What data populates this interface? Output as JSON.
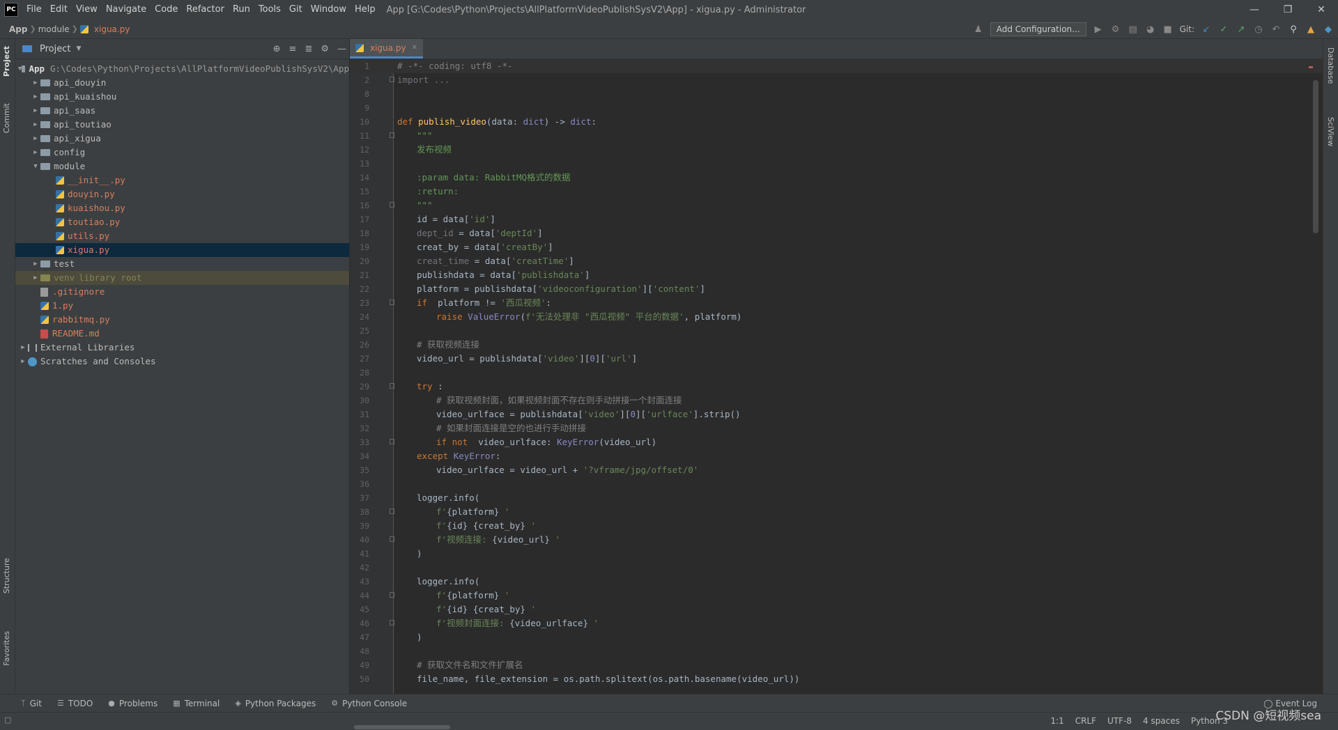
{
  "titlebar": {
    "logo": "PC",
    "menu": [
      "File",
      "Edit",
      "View",
      "Navigate",
      "Code",
      "Refactor",
      "Run",
      "Tools",
      "Git",
      "Window",
      "Help"
    ],
    "window_title": "App [G:\\Codes\\Python\\Projects\\AllPlatformVideoPublishSysV2\\App] - xigua.py - Administrator"
  },
  "navbar": {
    "breadcrumbs": [
      "App",
      "module",
      "xigua.py"
    ],
    "add_config": "Add Configuration...",
    "git_label": "Git:"
  },
  "left_stripe": {
    "project": "Project",
    "commit": "Commit",
    "structure": "Structure",
    "favorites": "Favorites"
  },
  "right_stripe": {
    "database": "Database",
    "sciview": "SciView"
  },
  "project_panel": {
    "title": "Project",
    "root_name": "App",
    "root_path": "G:\\Codes\\Python\\Projects\\AllPlatformVideoPublishSysV2\\App",
    "folders": [
      "api_douyin",
      "api_kuaishou",
      "api_saas",
      "api_toutiao",
      "api_xigua",
      "config"
    ],
    "module_name": "module",
    "module_files": [
      "__init__.py",
      "douyin.py",
      "kuaishou.py",
      "toutiao.py",
      "utils.py",
      "xigua.py"
    ],
    "test": "test",
    "venv": "venv",
    "venv_note": "library root",
    "root_files": [
      ".gitignore",
      "1.py",
      "rabbitmq.py",
      "README.md"
    ],
    "external": "External Libraries",
    "scratches": "Scratches and Consoles"
  },
  "editor": {
    "tab": "xigua.py",
    "line_numbers": [
      "1",
      "2",
      "8",
      "9",
      "10",
      "11",
      "12",
      "13",
      "14",
      "15",
      "16",
      "17",
      "18",
      "19",
      "20",
      "21",
      "22",
      "23",
      "24",
      "25",
      "26",
      "27",
      "28",
      "29",
      "30",
      "31",
      "32",
      "33",
      "34",
      "35",
      "36",
      "37",
      "38",
      "39",
      "40",
      "41",
      "42",
      "43",
      "44",
      "45",
      "46",
      "47",
      "48",
      "49",
      "50"
    ]
  },
  "code": {
    "l1": "# -*- coding: utf8 -*-",
    "l2": "import ...",
    "l10a": "def",
    "l10b": "publish_video",
    "l10c": "(data: ",
    "l10d": "dict",
    "l10e": ") -> ",
    "l10f": "dict",
    "l10g": ":",
    "l11": "\"\"\"",
    "l12": "发布视频",
    "l14": ":param data: RabbitMQ格式的数据",
    "l15": ":return:",
    "l16": "\"\"\"",
    "l17a": "id = data[",
    "l17b": "'id'",
    "l17c": "]",
    "l18a": "dept_id",
    "l18b": " = data[",
    "l18c": "'deptId'",
    "l18d": "]",
    "l19a": "creat_by = data[",
    "l19b": "'creatBy'",
    "l19c": "]",
    "l20a": "creat_time",
    "l20b": " = data[",
    "l20c": "'creatTime'",
    "l20d": "]",
    "l21a": "publishdata = data[",
    "l21b": "'publishdata'",
    "l21c": "]",
    "l22a": "platform = publishdata[",
    "l22b": "'videoconfiguration'",
    "l22c": "][",
    "l22d": "'content'",
    "l22e": "]",
    "l23a": "if",
    "l23b": " platform != ",
    "l23c": "'西瓜视频'",
    "l23d": ":",
    "l24a": "raise",
    "l24b": "ValueError",
    "l24c": "(",
    "l24d": "f'无法处理非 \"西瓜视频\" 平台的数据'",
    "l24e": ", platform)",
    "l26": "# 获取视频连接",
    "l27a": "video_url = publishdata[",
    "l27b": "'video'",
    "l27c": "][",
    "l27d": "0",
    "l27e": "][",
    "l27f": "'url'",
    "l27g": "]",
    "l29a": "try",
    "l29b": ":",
    "l30": "# 获取视频封面，如果视频封面不存在则手动拼接一个封面连接",
    "l31a": "video_urlface = publishdata[",
    "l31b": "'video'",
    "l31c": "][",
    "l31d": "0",
    "l31e": "][",
    "l31f": "'urlface'",
    "l31g": "].strip()",
    "l32": "# 如果封面连接是空的也进行手动拼接",
    "l33a": "if not",
    "l33b": " video_urlface: ",
    "l33c": "KeyError",
    "l33d": "(video_url)",
    "l34a": "except",
    "l34b": "KeyError",
    "l34c": ":",
    "l35a": "video_urlface = video_url + ",
    "l35b": "'?vframe/jpg/offset/0'",
    "l37": "logger.info(",
    "l38a": "f'",
    "l38b": "{platform}",
    "l38c": " '",
    "l39a": "f'",
    "l39b": "{id} {creat_by}",
    "l39c": " '",
    "l40a": "f'视频连接: ",
    "l40b": "{video_url}",
    "l40c": " '",
    "l41": ")",
    "l43": "logger.info(",
    "l44a": "f'",
    "l44b": "{platform}",
    "l44c": " '",
    "l45a": "f'",
    "l45b": "{id} {creat_by}",
    "l45c": " '",
    "l46a": "f'视频封面连接: ",
    "l46b": "{video_urlface}",
    "l46c": " '",
    "l47": ")",
    "l49": "# 获取文件名和文件扩展名",
    "l50": "file_name, file_extension = os.path.splitext(os.path.basename(video_url))"
  },
  "bottom_tools": [
    "Git",
    "TODO",
    "Problems",
    "Terminal",
    "Python Packages",
    "Python Console"
  ],
  "event_log": "Event Log",
  "status": {
    "position": "1:1",
    "line_sep": "CRLF",
    "encoding": "UTF-8",
    "indent": "4 spaces",
    "interpreter": "Python 3"
  },
  "watermark": "CSDN @短视频sea"
}
